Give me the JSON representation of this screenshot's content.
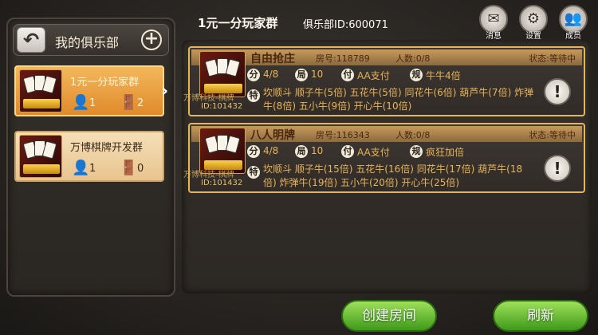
{
  "left": {
    "title": "我的俱乐部",
    "back_icon": "back-arrow-icon",
    "add_icon": "plus-icon",
    "clubs": [
      {
        "name": "1元一分玩家群",
        "members": "1",
        "rooms": "2",
        "active": true
      },
      {
        "name": "万博棋牌开发群",
        "members": "1",
        "rooms": "0",
        "active": false
      }
    ]
  },
  "header": {
    "title": "1元一分玩家群",
    "club_id": "俱乐部ID:600071",
    "buttons": [
      {
        "label": "消息",
        "icon": "mail-icon"
      },
      {
        "label": "设置",
        "icon": "gear-icon"
      },
      {
        "label": "成员",
        "icon": "members-icon"
      }
    ]
  },
  "rooms": [
    {
      "name": "自由抢庄",
      "room_no": "房号:118789",
      "people": "人数:0/8",
      "status": "状态:等待中",
      "watermark": "万博科技-棋牌",
      "id": "ID:101432",
      "fen": "4/8",
      "ju": "10",
      "fu": "AA支付",
      "gui": "牛牛4倍",
      "te": "坎顺斗 顺子牛(5倍) 五花牛(5倍) 同花牛(6倍) 葫芦牛(7倍) 炸弹牛(8倍) 五小牛(9倍) 开心牛(10倍)"
    },
    {
      "name": "八人明牌",
      "room_no": "房号:116343",
      "people": "人数:0/8",
      "status": "状态:等待中",
      "watermark": "万博科技-棋牌",
      "id": "ID:101432",
      "fen": "4/8",
      "ju": "10",
      "fu": "AA支付",
      "gui": "疯狂加倍",
      "te": "坎顺斗 顺子牛(15倍) 五花牛(16倍) 同花牛(17倍) 葫芦牛(18倍) 炸弹牛(19倍) 五小牛(20倍) 开心牛(25倍)"
    }
  ],
  "tags": {
    "fen": "分",
    "ju": "局",
    "fu": "付",
    "gui": "规",
    "te": "特"
  },
  "buttons": {
    "create": "创建房间",
    "refresh": "刷新"
  }
}
